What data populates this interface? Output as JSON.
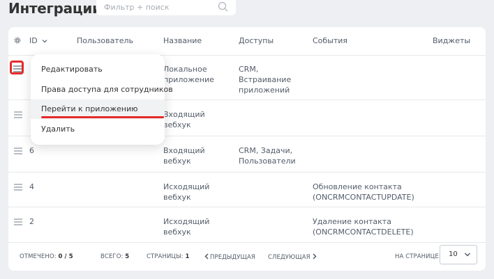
{
  "page": {
    "title": "Интеграции"
  },
  "search": {
    "placeholder": "Фильтр + поиск"
  },
  "table": {
    "headers": {
      "id": "ID",
      "user": "Пользователь",
      "name": "Название",
      "access": "Доступы",
      "events": "События",
      "widgets": "Виджеты"
    },
    "rows": [
      {
        "id": "",
        "name": "Локальное приложение",
        "access": "CRM, Встраивание приложений",
        "events": ""
      },
      {
        "id": "",
        "name": "Входящий вебхук",
        "access": "",
        "events": ""
      },
      {
        "id": "6",
        "name": "Входящий вебхук",
        "access": "CRM, Задачи, Пользователи",
        "events": ""
      },
      {
        "id": "4",
        "name": "Исходящий вебхук",
        "access": "",
        "events": "Обновление контакта (ONCRMCONTACTUPDATE)"
      },
      {
        "id": "2",
        "name": "Исходящий вебхук",
        "access": "",
        "events": "Удаление контакта (ONCRMCONTACTDELETE)"
      }
    ]
  },
  "menu": {
    "items": [
      "Редактировать",
      "Права доступа для сотрудников",
      "Перейти к приложению",
      "Удалить"
    ]
  },
  "footer": {
    "selected_label": "Отмечено:",
    "selected_value": "0 / 5",
    "total_label": "Всего:",
    "total_value": "5",
    "pages_label": "Страницы:",
    "pages_value": "1",
    "prev": "Предыдущая",
    "next": "Следующая",
    "per_page_label": "На странице:",
    "per_page_value": "10"
  },
  "colors": {
    "highlight": "#e62a2a",
    "background": "#edeff2"
  }
}
